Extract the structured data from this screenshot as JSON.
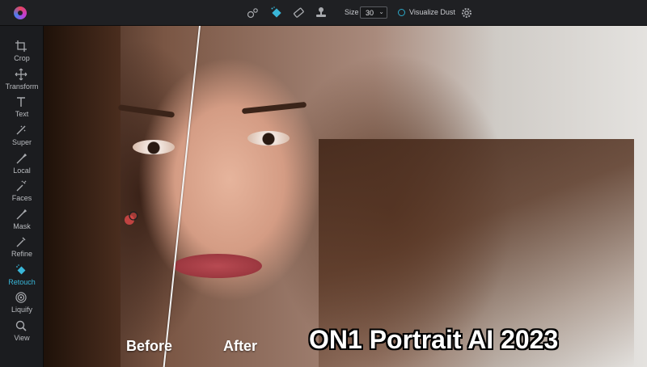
{
  "toolbar": {
    "size_label": "Size",
    "size_value": "30",
    "visualize_dust_label": "Visualize Dust",
    "icons": [
      "logo-icon",
      "spot-heal-icon",
      "retouch-brush-icon",
      "eraser-icon",
      "clone-stamp-icon",
      "gear-icon"
    ]
  },
  "sidebar": {
    "items": [
      {
        "label": "Crop",
        "icon": "crop-icon"
      },
      {
        "label": "Transform",
        "icon": "transform-icon"
      },
      {
        "label": "Text",
        "icon": "text-icon"
      },
      {
        "label": "Super",
        "icon": "super-icon"
      },
      {
        "label": "Local",
        "icon": "local-brush-icon"
      },
      {
        "label": "Faces",
        "icon": "faces-icon"
      },
      {
        "label": "Mask",
        "icon": "mask-icon"
      },
      {
        "label": "Refine",
        "icon": "refine-icon"
      },
      {
        "label": "Retouch",
        "icon": "retouch-icon",
        "active": true
      },
      {
        "label": "Liquify",
        "icon": "liquify-icon"
      },
      {
        "label": "View",
        "icon": "view-icon"
      }
    ]
  },
  "canvas": {
    "before_label": "Before",
    "after_label": "After",
    "overlay_title": "ON1 Portrait AI 2023"
  },
  "colors": {
    "accent": "#39b6d8",
    "brush": "#e04a4a"
  }
}
